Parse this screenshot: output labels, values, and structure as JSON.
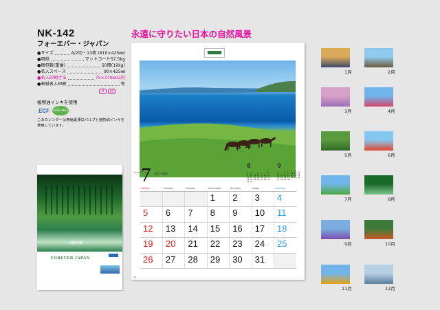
{
  "product": {
    "code": "NK-142",
    "name": "フォーエバー・ジャパン",
    "tagline": "永遠に守りたい日本の自然風景"
  },
  "specs": [
    {
      "key": "サイズ",
      "value": "A/2切・13枚 (610×425㎜)",
      "highlight": false
    },
    {
      "key": "用紙",
      "value": "マットコート57.5kg",
      "highlight": false
    },
    {
      "key": "梱包数(重量)",
      "value": "50冊(19kg)",
      "highlight": false
    },
    {
      "key": "名入スペース",
      "value": "90×425㎜",
      "highlight": false
    },
    {
      "key": "名入印刷寸法",
      "value": "75×370㎜以内",
      "highlight": true
    },
    {
      "key": "表紙名入印刷",
      "value": "有",
      "highlight": false
    }
  ],
  "badges": [
    "0",
    "回"
  ],
  "eco": {
    "title": "植物油インキを使用",
    "ecf": "ECF",
    "vegetable": "VEGETABLE OIL INK",
    "note": "このカレンダーは無塩素漂白パルプと植物油インキを使用しています。"
  },
  "cover": {
    "title": "水鏡の森",
    "brand": "FOREVER JAPAN"
  },
  "calendar": {
    "month": "7",
    "month_en": "JULY 2026",
    "weekday_headers": [
      "sunday",
      "monday",
      "tuesday",
      "wednesday",
      "thursday",
      "friday",
      "saturday"
    ],
    "weeks": [
      [
        "",
        "",
        "",
        "1",
        "2",
        "3",
        "4"
      ],
      [
        "5",
        "6",
        "7",
        "8",
        "9",
        "10",
        "11"
      ],
      [
        "12",
        "13",
        "14",
        "15",
        "16",
        "17",
        "18"
      ],
      [
        "19",
        "20",
        "21",
        "22",
        "23",
        "24",
        "25"
      ],
      [
        "26",
        "27",
        "28",
        "29",
        "30",
        "31",
        ""
      ]
    ],
    "holidays": [
      "20"
    ],
    "prev_month": "8",
    "next_month": "9"
  },
  "thumbnails": [
    {
      "label": "1月",
      "sky": "#dba95a",
      "land": "#3c4a6a"
    },
    {
      "label": "2月",
      "sky": "#8fc9ee",
      "land": "#6a5a3a"
    },
    {
      "label": "3月",
      "sky": "#d7a0c8",
      "land": "#9b6fb8"
    },
    {
      "label": "4月",
      "sky": "#6fb4ea",
      "land": "#d5466c"
    },
    {
      "label": "5月",
      "sky": "#5a9a3f",
      "land": "#2f6a28"
    },
    {
      "label": "6月",
      "sky": "#86c7f0",
      "land": "#e04730"
    },
    {
      "label": "7月",
      "sky": "#6fb7ea",
      "land": "#4ca83a"
    },
    {
      "label": "8月",
      "sky": "#1a6a2a",
      "land": "#7cc38a"
    },
    {
      "label": "9月",
      "sky": "#7aaee0",
      "land": "#7a4cb0"
    },
    {
      "label": "10月",
      "sky": "#3d7a3a",
      "land": "#c85a28"
    },
    {
      "label": "11月",
      "sky": "#6fb4ea",
      "land": "#e3a21a"
    },
    {
      "label": "12月",
      "sky": "#b6cfe3",
      "land": "#5a7f9d"
    }
  ],
  "colors": {
    "accent": "#e6139e",
    "sunday": "#e11c1c",
    "saturday": "#2b9ee6"
  }
}
